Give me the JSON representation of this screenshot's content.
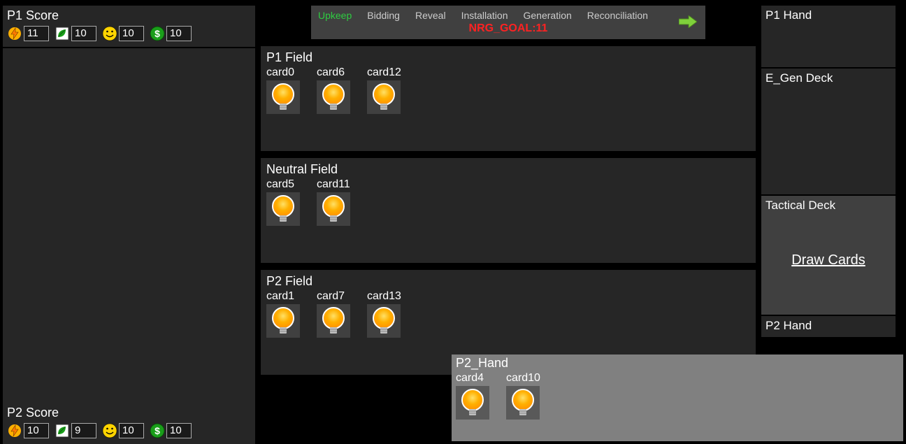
{
  "p1_score": {
    "title": "P1 Score",
    "energy": "11",
    "eco": "10",
    "happy": "10",
    "money": "10"
  },
  "p2_score": {
    "title": "P2 Score",
    "energy": "10",
    "eco": "9",
    "happy": "10",
    "money": "10"
  },
  "phases": {
    "items": [
      "Upkeep",
      "Bidding",
      "Reveal",
      "Installation",
      "Generation",
      "Reconciliation"
    ],
    "active_index": 0,
    "nrg_goal_label": "NRG_GOAL:11"
  },
  "p1_field": {
    "title": "P1 Field",
    "cards": [
      "card0",
      "card6",
      "card12"
    ]
  },
  "neutral_field": {
    "title": "Neutral Field",
    "cards": [
      "card5",
      "card11"
    ]
  },
  "p2_field": {
    "title": "P2 Field",
    "cards": [
      "card1",
      "card7",
      "card13"
    ]
  },
  "p2_hand_overlay": {
    "title": "P2_Hand",
    "cards": [
      "card4",
      "card10"
    ]
  },
  "right": {
    "p1_hand": "P1 Hand",
    "egen_deck": "E_Gen Deck",
    "tactical_deck": "Tactical Deck",
    "draw_label": "Draw Cards",
    "p2_hand": "P2 Hand"
  }
}
